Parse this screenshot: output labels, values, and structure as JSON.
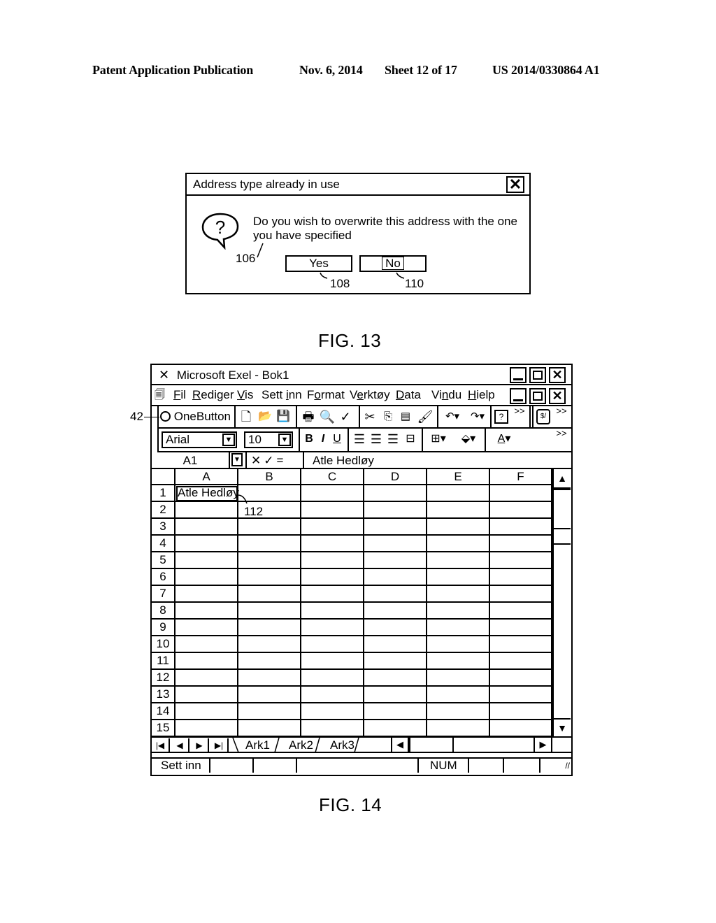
{
  "header": {
    "publication": "Patent Application Publication",
    "date": "Nov. 6, 2014",
    "sheet": "Sheet 12 of 17",
    "number": "US 2014/0330864 A1"
  },
  "fig13": {
    "caption": "FIG. 13",
    "dialog": {
      "title": "Address type already in use",
      "close_glyph": "✕",
      "message_line1": "Do you wish to overwrite this address with the one",
      "message_line2": "you have specified",
      "icon": "question-bubble-icon",
      "yes_label": "Yes",
      "no_label": "No"
    },
    "refs": {
      "icon": "106",
      "yes": "108",
      "no": "110"
    }
  },
  "fig14": {
    "caption": "FIG. 14",
    "window_title": "Microsoft Exel - Bok1",
    "menu": [
      {
        "pre": "",
        "ul": "F",
        "post": "il"
      },
      {
        "pre": "",
        "ul": "R",
        "post": "ediger"
      },
      {
        "pre": "",
        "ul": "V",
        "post": "is"
      },
      {
        "pre": "Sett ",
        "ul": "i",
        "post": "nn"
      },
      {
        "pre": "F",
        "ul": "o",
        "post": "rmat"
      },
      {
        "pre": "V",
        "ul": "e",
        "post": "rktøy"
      },
      {
        "pre": "",
        "ul": "D",
        "post": "ata"
      },
      {
        "pre": "Vi",
        "ul": "n",
        "post": "du"
      },
      {
        "pre": "",
        "ul": "H",
        "post": "ielp"
      }
    ],
    "onebutton_label": "OneButton",
    "onebutton_ref": "42",
    "font_name": "Arial",
    "font_size": "10",
    "bold": "B",
    "italic": "I",
    "underline": "U",
    "more": ">>",
    "name_box": "A1",
    "formula_value": "Atle Hedløy",
    "columns": [
      "A",
      "B",
      "C",
      "D",
      "E",
      "F"
    ],
    "rows": [
      "1",
      "2",
      "3",
      "4",
      "5",
      "6",
      "7",
      "8",
      "9",
      "10",
      "11",
      "12",
      "13",
      "14",
      "15"
    ],
    "cell_a1": "Atle Hedløy",
    "cell_ref": "112",
    "sheets": [
      "Ark1",
      "Ark2",
      "Ark3"
    ],
    "status": {
      "mode": "Sett inn",
      "num": "NUM"
    }
  }
}
